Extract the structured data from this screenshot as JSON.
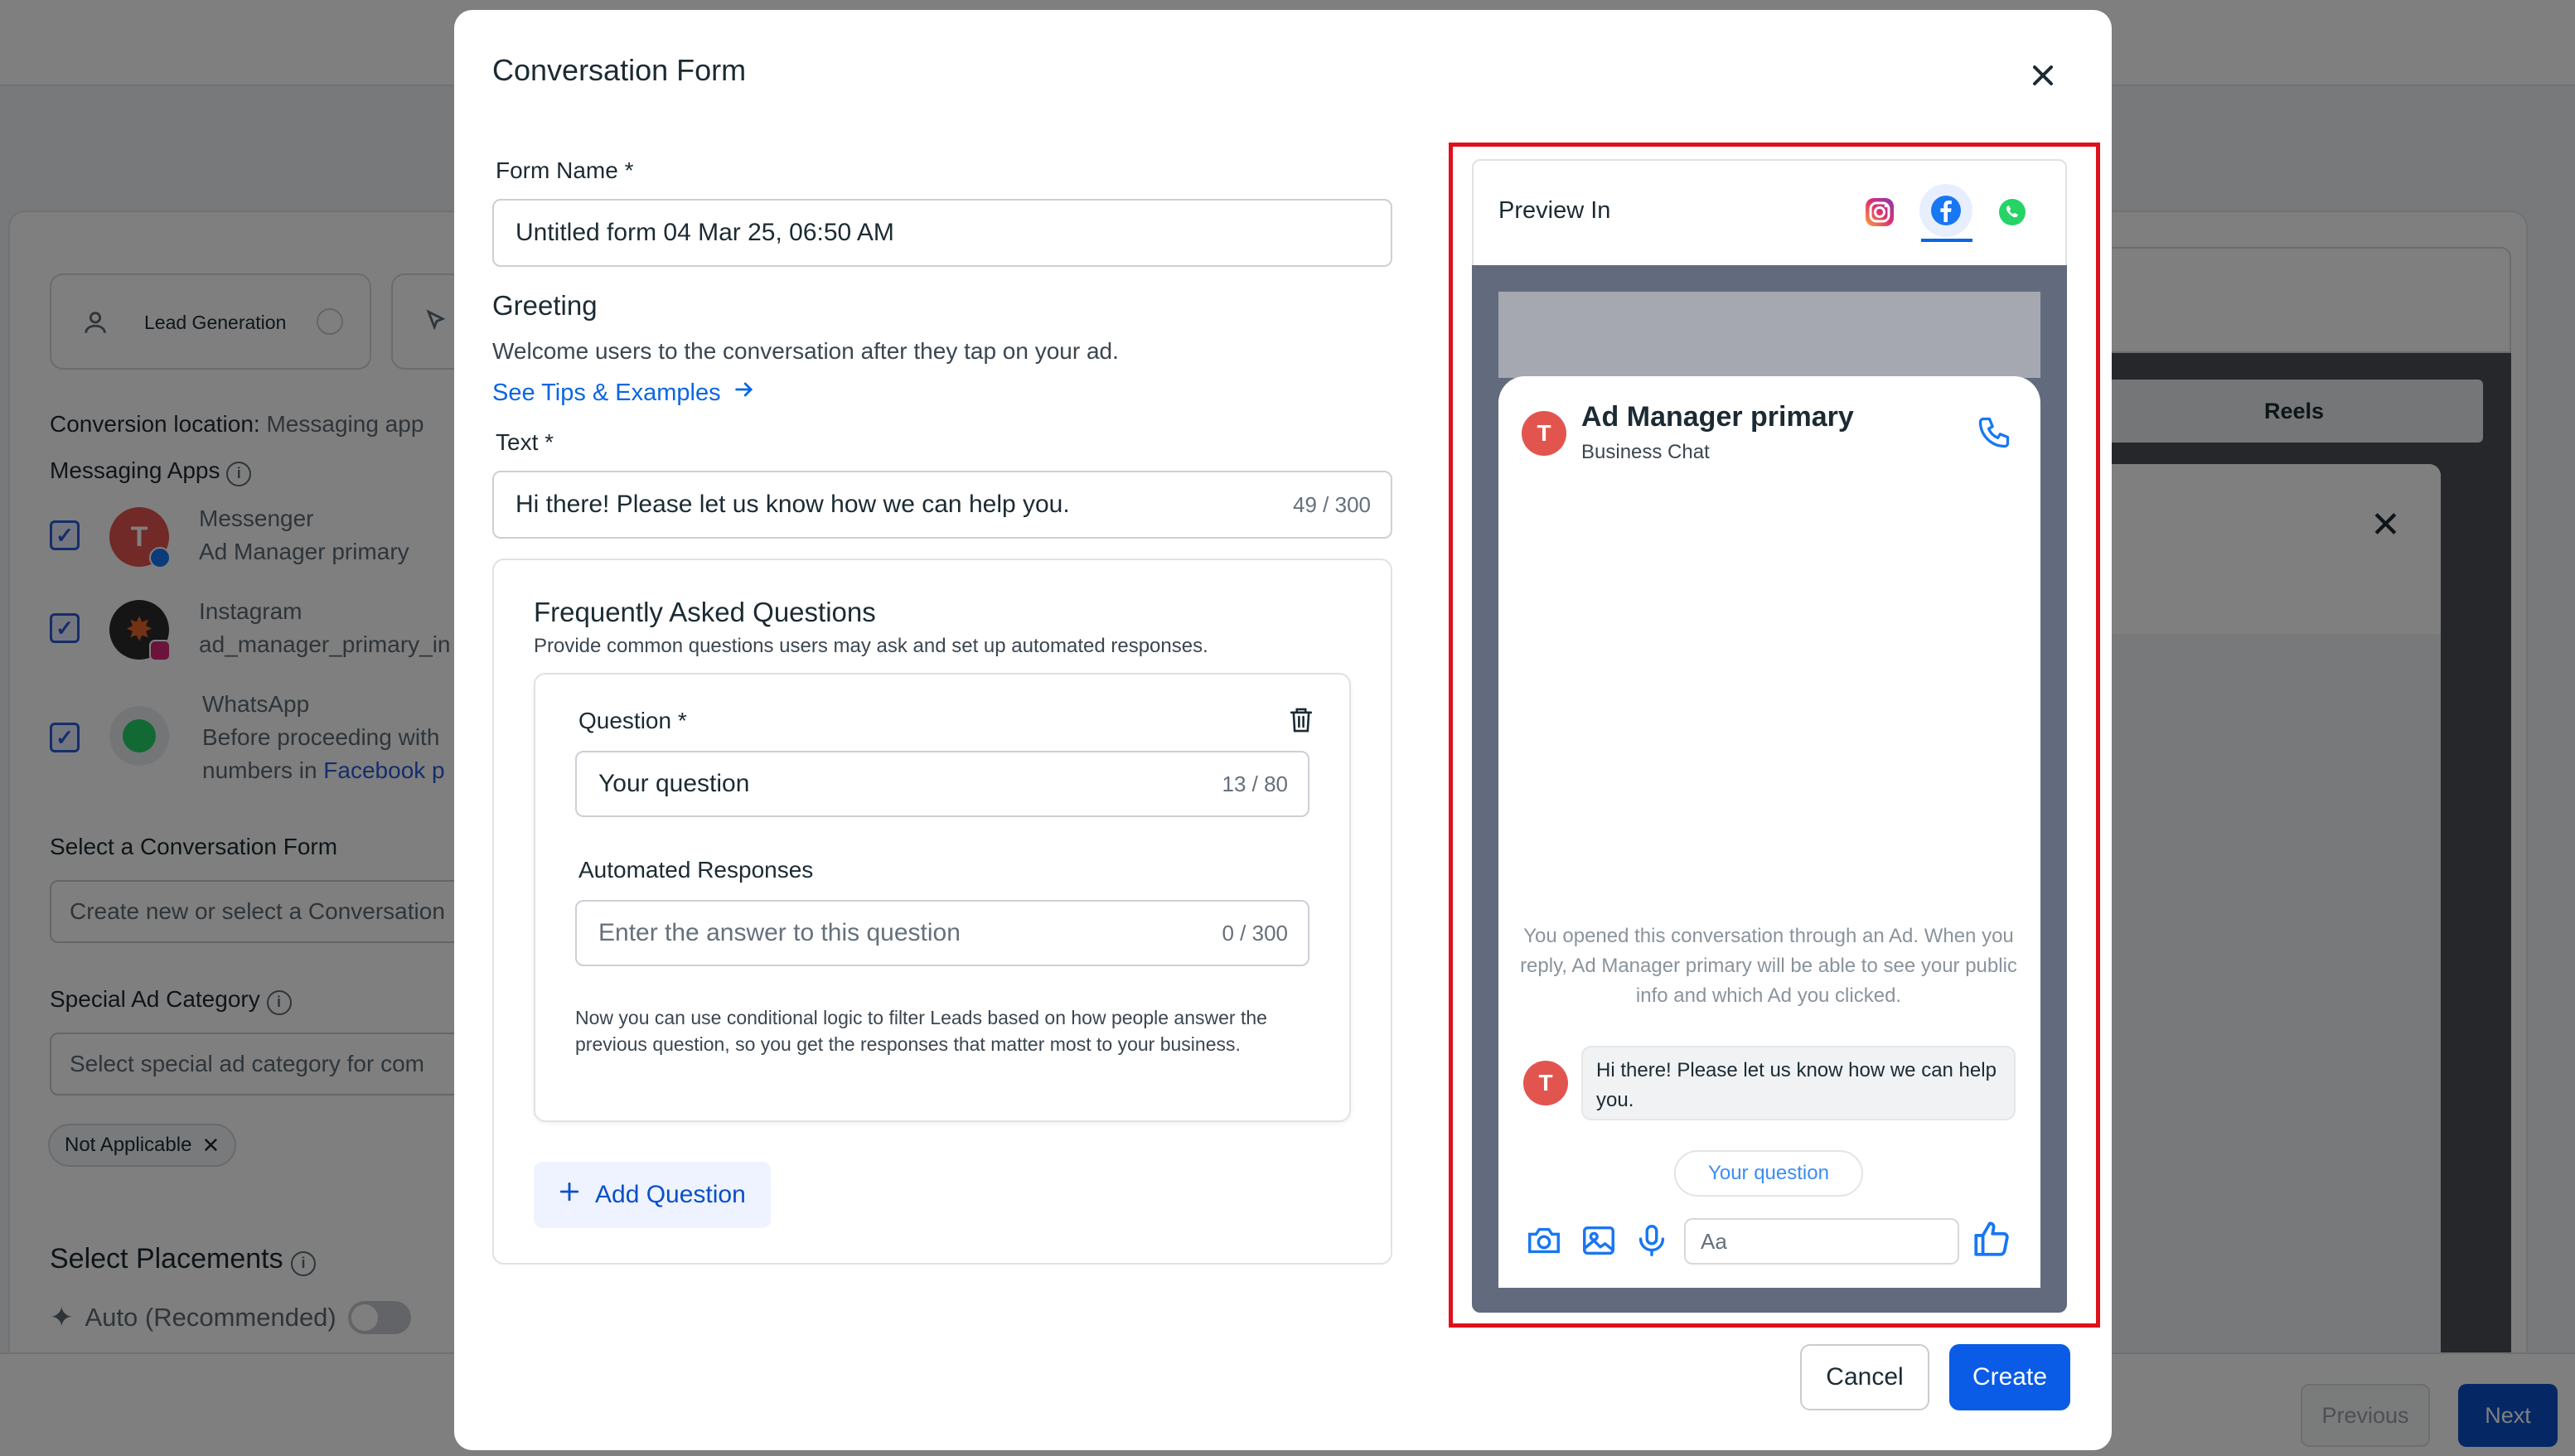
{
  "background": {
    "tabs": {
      "lead_generation": "Lead Generation"
    },
    "conversion_location": {
      "label": "Conversion location:",
      "value": "Messaging app"
    },
    "messaging_apps": {
      "title": "Messaging Apps",
      "items": [
        {
          "app": "Messenger",
          "account": "Ad Manager primary",
          "avatar_letter": "T"
        },
        {
          "app": "Instagram",
          "account": "ad_manager_primary_in"
        },
        {
          "app": "WhatsApp",
          "account": "Before proceeding with",
          "account_line2_prefix": "numbers in ",
          "account_line2_link": "Facebook p"
        }
      ]
    },
    "conversation_form": {
      "label": "Select a Conversation Form",
      "placeholder": "Create new or select a Conversation"
    },
    "special_ad_category": {
      "label": "Special Ad Category",
      "placeholder": "Select special ad category for com",
      "chip": "Not Applicable"
    },
    "placements": {
      "title": "Select Placements",
      "auto_label": "Auto (Recommended)"
    },
    "preview_tabs": {
      "reels": "Reels"
    },
    "footer": {
      "previous": "Previous",
      "next": "Next"
    }
  },
  "modal": {
    "title": "Conversation Form",
    "form_name": {
      "label": "Form Name *",
      "value": "Untitled form 04 Mar 25, 06:50 AM"
    },
    "greeting": {
      "title": "Greeting",
      "description": "Welcome users to the conversation after they tap on your ad.",
      "tips_link": "See Tips & Examples"
    },
    "text": {
      "label": "Text *",
      "value": "Hi there! Please let us know how we can help you.",
      "counter": "49 / 300"
    },
    "faq": {
      "title": "Frequently Asked Questions",
      "description": "Provide common questions users may ask and set up automated responses.",
      "question": {
        "label": "Question *",
        "value": "Your question",
        "counter": "13 / 80"
      },
      "responses": {
        "label": "Automated Responses",
        "placeholder": "Enter the answer to this question",
        "counter": "0 / 300"
      },
      "note": "Now you can use conditional logic to filter Leads based on how people answer the previous question, so you get the responses that matter most to your business.",
      "add_button": "Add Question"
    },
    "preview": {
      "label": "Preview In",
      "platforms": [
        "instagram-icon",
        "facebook-icon",
        "whatsapp-icon"
      ],
      "selected_platform": "facebook",
      "chat": {
        "avatar_letter": "T",
        "page_name": "Ad Manager primary",
        "subtitle": "Business Chat",
        "notice": "You opened this conversation through an Ad. When you reply, Ad Manager primary will be able to see your public info and which Ad you clicked.",
        "message": "Hi there! Please let us know how we can help you.",
        "quick_reply": "Your question",
        "composer_placeholder": "Aa"
      }
    },
    "buttons": {
      "cancel": "Cancel",
      "create": "Create"
    }
  },
  "colors": {
    "accent": "#0a5ce6",
    "link": "#0a66e4",
    "highlight_frame": "#e0101a",
    "avatar": "#e2554f"
  }
}
